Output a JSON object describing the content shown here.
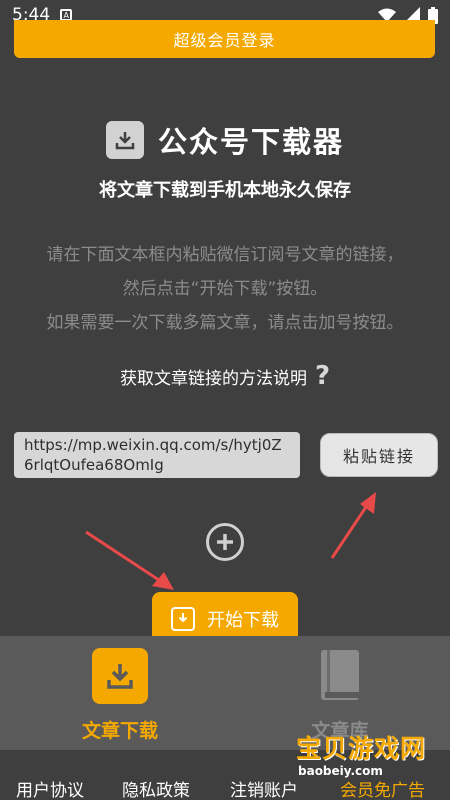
{
  "status_bar": {
    "time": "5:44"
  },
  "header": {
    "vip_login_label": "超级会员登录"
  },
  "main": {
    "title": "公众号下载器",
    "subtitle": "将文章下载到手机本地永久保存",
    "instructions": [
      "请在下面文本框内粘贴微信订阅号文章的链接，",
      "然后点击“开始下载”按钮。",
      "如果需要一次下载多篇文章，请点击加号按钮。"
    ],
    "help_label": "获取文章链接的方法说明",
    "link_value": "https://mp.weixin.qq.com/s/hytj0Z6rlqtOufea68OmIg",
    "paste_label": "粘贴链接",
    "start_label": "开始下载"
  },
  "nav": {
    "download_label": "文章下载",
    "library_label": "文章库"
  },
  "footer": {
    "user_agreement": "用户协议",
    "privacy_policy": "隐私政策",
    "cancel_account": "注销账户",
    "vip_no_ads": "会员免广告"
  },
  "watermark": {
    "title": "宝贝游戏网",
    "url": "baobeiy.com"
  },
  "colors": {
    "accent": "#f5a900",
    "background": "#3f3f3f",
    "nav_background": "#5a5a5a",
    "arrow": "#e84a4a"
  }
}
